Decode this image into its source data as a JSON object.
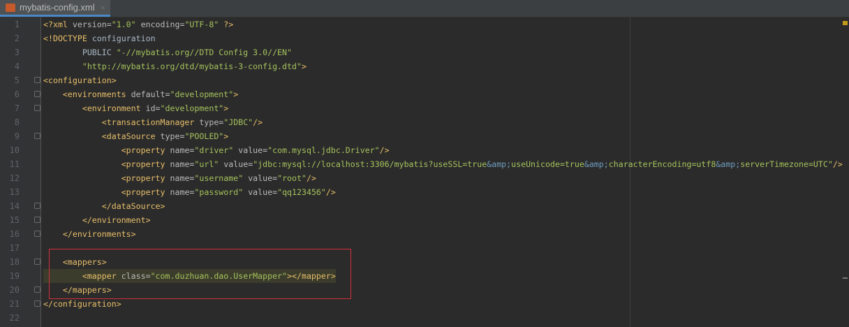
{
  "tab": {
    "title": "mybatis-config.xml",
    "close": "×"
  },
  "lines": [
    [
      [
        "tag",
        "<?xml "
      ],
      [
        "attr",
        "version="
      ],
      [
        "val",
        "\"1.0\""
      ],
      [
        "attr",
        " encoding="
      ],
      [
        "val",
        "\"UTF-8\""
      ],
      [
        "tag",
        " ?>"
      ]
    ],
    [
      [
        "tag",
        "<!DOCTYPE "
      ],
      [
        "txt",
        "configuration"
      ]
    ],
    [
      [
        "txt",
        "        PUBLIC "
      ],
      [
        "val",
        "\"-//mybatis.org//DTD Config 3.0//EN\""
      ]
    ],
    [
      [
        "txt",
        "        "
      ],
      [
        "val",
        "\"http://mybatis.org/dtd/mybatis-3-config.dtd\""
      ],
      [
        "tag",
        ">"
      ]
    ],
    [
      [
        "tag",
        "<configuration>"
      ]
    ],
    [
      [
        "txt",
        "    "
      ],
      [
        "tag",
        "<environments "
      ],
      [
        "attr",
        "default="
      ],
      [
        "val",
        "\"development\""
      ],
      [
        "tag",
        ">"
      ]
    ],
    [
      [
        "txt",
        "        "
      ],
      [
        "tag",
        "<environment "
      ],
      [
        "attr",
        "id="
      ],
      [
        "val",
        "\"development\""
      ],
      [
        "tag",
        ">"
      ]
    ],
    [
      [
        "txt",
        "            "
      ],
      [
        "tag",
        "<transactionManager "
      ],
      [
        "attr",
        "type="
      ],
      [
        "val",
        "\"JDBC\""
      ],
      [
        "tag",
        "/>"
      ]
    ],
    [
      [
        "txt",
        "            "
      ],
      [
        "tag",
        "<dataSource "
      ],
      [
        "attr",
        "type="
      ],
      [
        "val",
        "\"POOLED\""
      ],
      [
        "tag",
        ">"
      ]
    ],
    [
      [
        "txt",
        "                "
      ],
      [
        "tag",
        "<property "
      ],
      [
        "attr",
        "name="
      ],
      [
        "val",
        "\"driver\""
      ],
      [
        "attr",
        " value="
      ],
      [
        "val",
        "\"com.mysql.jdbc.Driver\""
      ],
      [
        "tag",
        "/>"
      ]
    ],
    [
      [
        "txt",
        "                "
      ],
      [
        "tag",
        "<property "
      ],
      [
        "attr",
        "name="
      ],
      [
        "val",
        "\"url\""
      ],
      [
        "attr",
        " value="
      ],
      [
        "val",
        "\"jdbc:mysql://localhost:3306/mybatis?useSSL=true"
      ],
      [
        "ent",
        "&amp;"
      ],
      [
        "val",
        "useUnicode=true"
      ],
      [
        "ent",
        "&amp;"
      ],
      [
        "val",
        "characterEncoding=utf8"
      ],
      [
        "ent",
        "&amp;"
      ],
      [
        "val",
        "serverTimezone=UTC\""
      ],
      [
        "tag",
        "/>"
      ]
    ],
    [
      [
        "txt",
        "                "
      ],
      [
        "tag",
        "<property "
      ],
      [
        "attr",
        "name="
      ],
      [
        "val",
        "\"username\""
      ],
      [
        "attr",
        " value="
      ],
      [
        "val",
        "\"root\""
      ],
      [
        "tag",
        "/>"
      ]
    ],
    [
      [
        "txt",
        "                "
      ],
      [
        "tag",
        "<property "
      ],
      [
        "attr",
        "name="
      ],
      [
        "val",
        "\"password\""
      ],
      [
        "attr",
        " value="
      ],
      [
        "val",
        "\"qq123456\""
      ],
      [
        "tag",
        "/>"
      ]
    ],
    [
      [
        "txt",
        "            "
      ],
      [
        "tag",
        "</dataSource>"
      ]
    ],
    [
      [
        "txt",
        "        "
      ],
      [
        "tag",
        "</environment>"
      ]
    ],
    [
      [
        "txt",
        "    "
      ],
      [
        "tag",
        "</environments>"
      ]
    ],
    [],
    [
      [
        "txt",
        "    "
      ],
      [
        "tag",
        "<mappers>"
      ]
    ],
    [
      [
        "txt",
        "        "
      ],
      [
        "tag",
        "<mapper "
      ],
      [
        "attr",
        "class="
      ],
      [
        "val",
        "\"com.duzhuan.dao.UserMapper\""
      ],
      [
        "tag",
        "></mapper>"
      ]
    ],
    [
      [
        "txt",
        "    "
      ],
      [
        "tag",
        "</mappers>"
      ]
    ],
    [
      [
        "tag",
        "</configuration>"
      ]
    ],
    []
  ],
  "folds": [
    5,
    6,
    7,
    9,
    14,
    15,
    16,
    18,
    20,
    21
  ],
  "highlight_line": 19
}
